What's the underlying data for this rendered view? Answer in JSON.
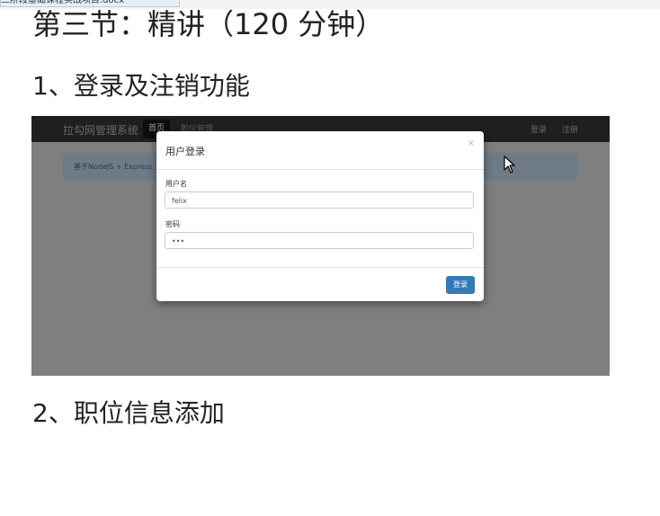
{
  "top_tab": "三阶段基础课程实战项目.docx",
  "section_heading": "第三节：精讲（120 分钟）",
  "item1": "1、登录及注销功能",
  "item2": "2、职位信息添加",
  "app": {
    "brand": "拉勾网管理系统",
    "nav_home": "首页",
    "nav_jobs": "职位管理",
    "nav_login": "登录",
    "nav_register": "注册",
    "alert_text": "基于NodeJS + Express +"
  },
  "modal": {
    "title": "用户登录",
    "close": "×",
    "username_label": "用户名",
    "username_value": "felix",
    "password_label": "密码",
    "password_value": "•••",
    "submit_label": "登录"
  }
}
